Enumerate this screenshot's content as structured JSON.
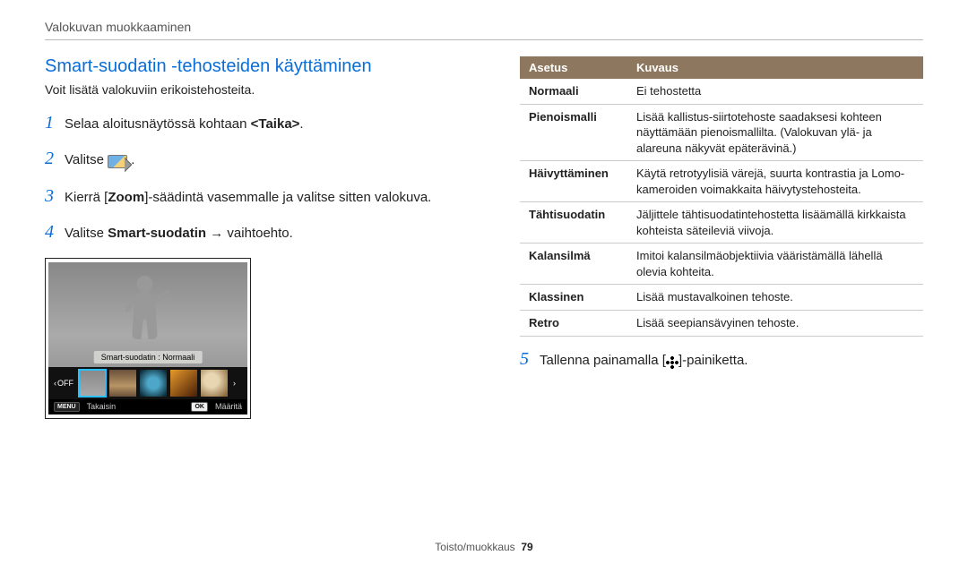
{
  "header": {
    "breadcrumb": "Valokuvan muokkaaminen"
  },
  "left": {
    "heading": "Smart-suodatin -tehosteiden käyttäminen",
    "subtitle": "Voit lisätä valokuviin erikoistehosteita.",
    "steps": {
      "s1_pre": "Selaa aloitusnäytössä kohtaan ",
      "s1_strong": "<Taika>",
      "s1_post": ".",
      "s2_pre": "Valitse ",
      "s2_post": " .",
      "s3_pre": "Kierrä [",
      "s3_strong": "Zoom",
      "s3_post": "]-säädintä vasemmalle ja valitse sitten valokuva.",
      "s4_pre": "Valitse ",
      "s4_strong": "Smart-suodatin",
      "s4_post": " → vaihtoehto."
    },
    "lcd": {
      "overlay": "Smart-suodatin : Normaali",
      "off": "OFF",
      "menu_label": "MENU",
      "back_label": "Takaisin",
      "ok_label": "OK",
      "confirm_label": "Määritä"
    }
  },
  "right": {
    "table": {
      "head_setting": "Asetus",
      "head_desc": "Kuvaus",
      "rows": [
        {
          "name": "Normaali",
          "desc": "Ei tehostetta"
        },
        {
          "name": "Pienoismalli",
          "desc": "Lisää kallistus-siirtotehoste saadaksesi kohteen näyttämään pienoismallilta. (Valokuvan ylä- ja alareuna näkyvät epäterävinä.)"
        },
        {
          "name": "Häivyttäminen",
          "desc": "Käytä retrotyylisiä värejä, suurta kontrastia ja Lomo-kameroiden voimakkaita häivytystehosteita."
        },
        {
          "name": "Tähtisuodatin",
          "desc": "Jäljittele tähtisuodatintehostetta lisäämällä kirkkaista kohteista säteileviä viivoja."
        },
        {
          "name": "Kalansilmä",
          "desc": "Imitoi kalansilmäobjektiivia vääristämällä lähellä olevia kohteita."
        },
        {
          "name": "Klassinen",
          "desc": "Lisää mustavalkoinen tehoste."
        },
        {
          "name": "Retro",
          "desc": "Lisää seepiansävyinen tehoste."
        }
      ]
    },
    "step5_pre": "Tallenna painamalla [",
    "step5_post": "]-painiketta."
  },
  "footer": {
    "section": "Toisto/muokkaus",
    "page": "79"
  }
}
